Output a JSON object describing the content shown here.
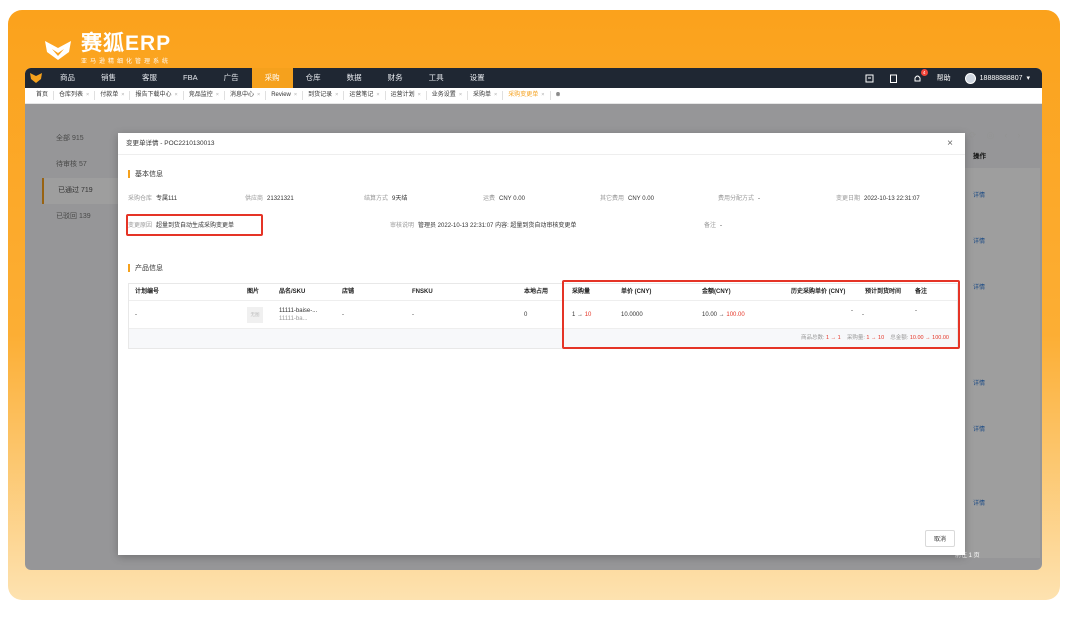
{
  "brand": {
    "name": "赛狐ERP",
    "tagline": "亚马逊精细化管理系统"
  },
  "nav": {
    "items": [
      "商品",
      "销售",
      "客服",
      "FBA",
      "广告",
      "采购",
      "仓库",
      "数据",
      "财务",
      "工具",
      "设置"
    ],
    "active_index": 5,
    "help": "帮助",
    "user": "18888888807",
    "notification_count": "4"
  },
  "tabs": {
    "items": [
      "首页",
      "仓库列表",
      "付款单",
      "报告下载中心",
      "竞品监控",
      "消息中心",
      "Review",
      "到货记录",
      "运营笔记",
      "运营计划",
      "业务设置",
      "采购单",
      "采购变更单"
    ],
    "active_index": 12
  },
  "sidebar": {
    "items": [
      {
        "label": "全部 915"
      },
      {
        "label": "待审核 57"
      },
      {
        "label": "已通过 719"
      },
      {
        "label": "已驳回 139"
      }
    ],
    "active_index": 2
  },
  "background": {
    "ops_header": "操作",
    "detail_link": "详情",
    "pager_text": "前往 1 页"
  },
  "modal": {
    "title": "变更单详情 - POC2210130013",
    "basic_section": "基本信息",
    "fields_row1": [
      {
        "label": "采购仓库",
        "value": "专属111"
      },
      {
        "label": "供应商",
        "value": "21321321"
      },
      {
        "label": "结算方式",
        "value": "9天结"
      },
      {
        "label": "运费",
        "value": "CNY 0.00"
      },
      {
        "label": "其它费用",
        "value": "CNY 0.00"
      },
      {
        "label": "费用分配方式",
        "value": "-"
      },
      {
        "label": "变更日期",
        "value": "2022-10-13 22:31:07"
      }
    ],
    "fields_row2": [
      {
        "label": "变更原因",
        "value": "超量到货自动生成采购变更单"
      },
      {
        "label": "审核说明",
        "value": "管理员 2022-10-13 22:31:07 内容: 超量到货自动审核变更单"
      },
      {
        "label": "备注",
        "value": "-"
      }
    ],
    "product_section": "产品信息",
    "columns": [
      "计划编号",
      "图片",
      "品名/SKU",
      "店铺",
      "FNSKU",
      "本地占用",
      "采购量",
      "单价 (CNY)",
      "金额(CNY)",
      "历史采购单价 (CNY)",
      "预计到货时间",
      "备注"
    ],
    "row": {
      "plan_no": "-",
      "image": "无图",
      "name": "11111-baise-...",
      "sku": "11111-ba...",
      "shop": "-",
      "fnsku": "-",
      "local_occupied": "0",
      "qty_from": "1 →",
      "qty_to": "10",
      "unit_price": "10.0000",
      "amount_from": "10.00 →",
      "amount_to": "100.00",
      "hist_price": "-",
      "eta": "-",
      "remark": "-"
    },
    "summary": {
      "goods_label": "商品总数:",
      "goods_value": "1 → 1",
      "qty_label": "采购量:",
      "qty_from": "1 →",
      "qty_to": "10",
      "total_label": "总金额:",
      "total_from": "10.00 →",
      "total_to": "100.00"
    },
    "cancel_label": "取消"
  },
  "colors": {
    "accent": "#f5a11d",
    "highlight_border": "#e53426",
    "nav_bg": "#1f2733"
  }
}
